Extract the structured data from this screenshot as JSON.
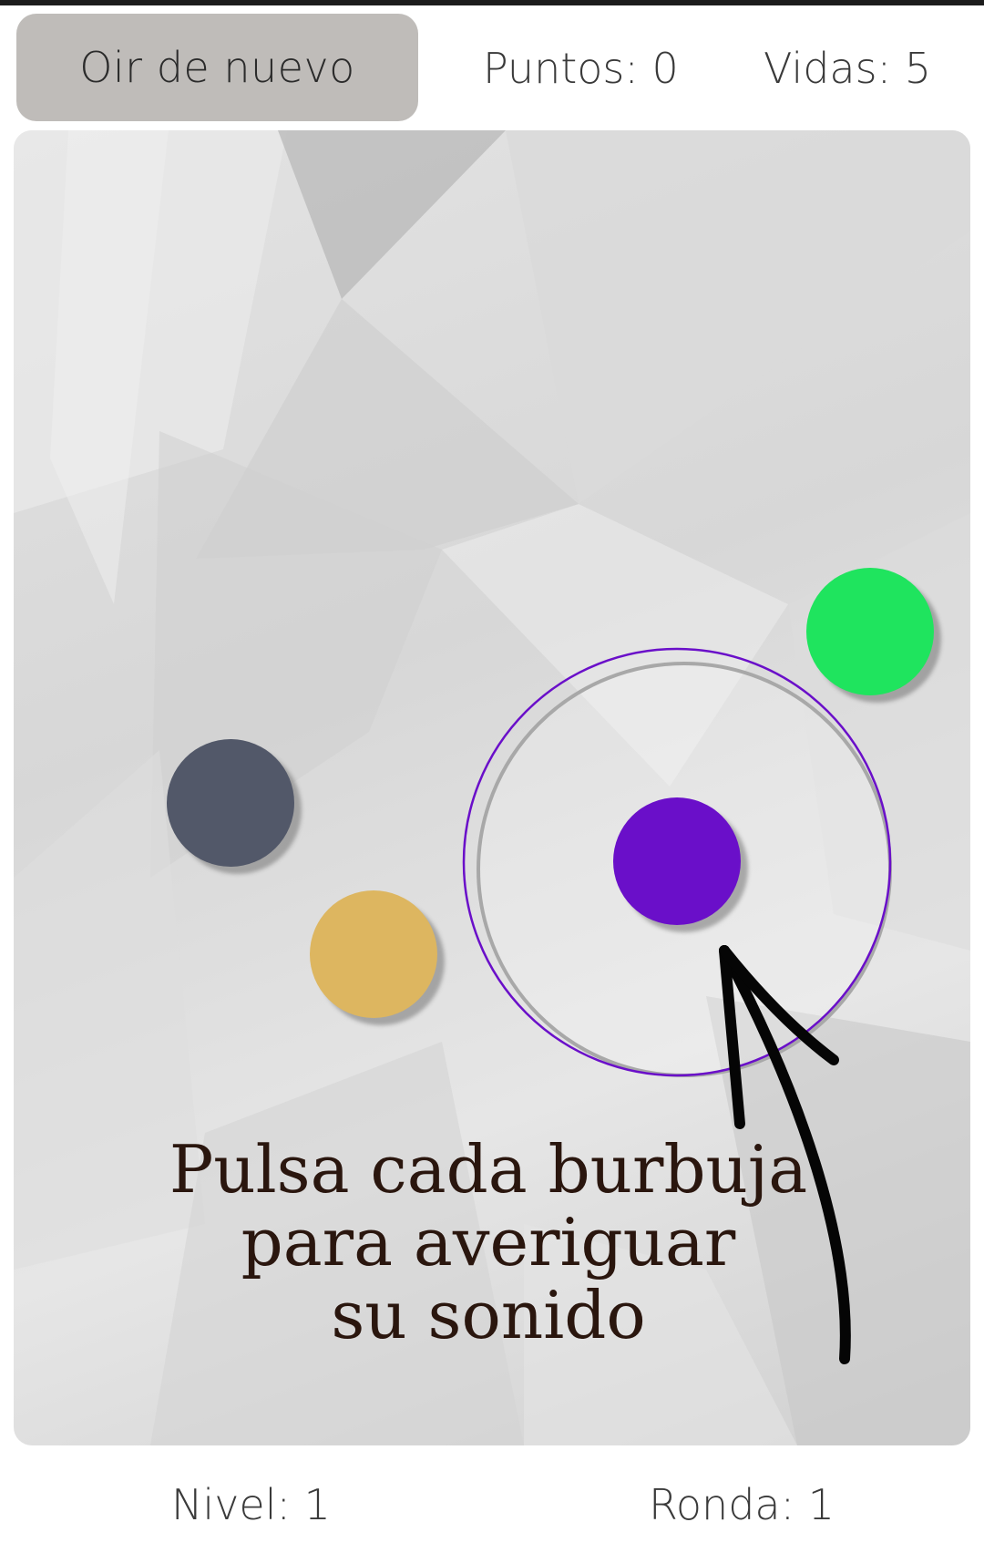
{
  "header": {
    "replay_label": "Oir de nuevo",
    "points_text": "Puntos: 0",
    "lives_text": "Vidas: 5"
  },
  "board": {
    "bubbles": [
      {
        "name": "dark-slate",
        "color": "#525869"
      },
      {
        "name": "gold",
        "color": "#ddb660"
      },
      {
        "name": "purple",
        "color": "#6a0fc9"
      },
      {
        "name": "green",
        "color": "#1fe45e"
      }
    ],
    "highlight_color": "#6a0fc9",
    "instruction_lines": [
      "Pulsa cada burbuja",
      "para averiguar",
      "su sonido"
    ]
  },
  "footer": {
    "level_text": "Nivel: 1",
    "round_text": "Ronda: 1"
  }
}
